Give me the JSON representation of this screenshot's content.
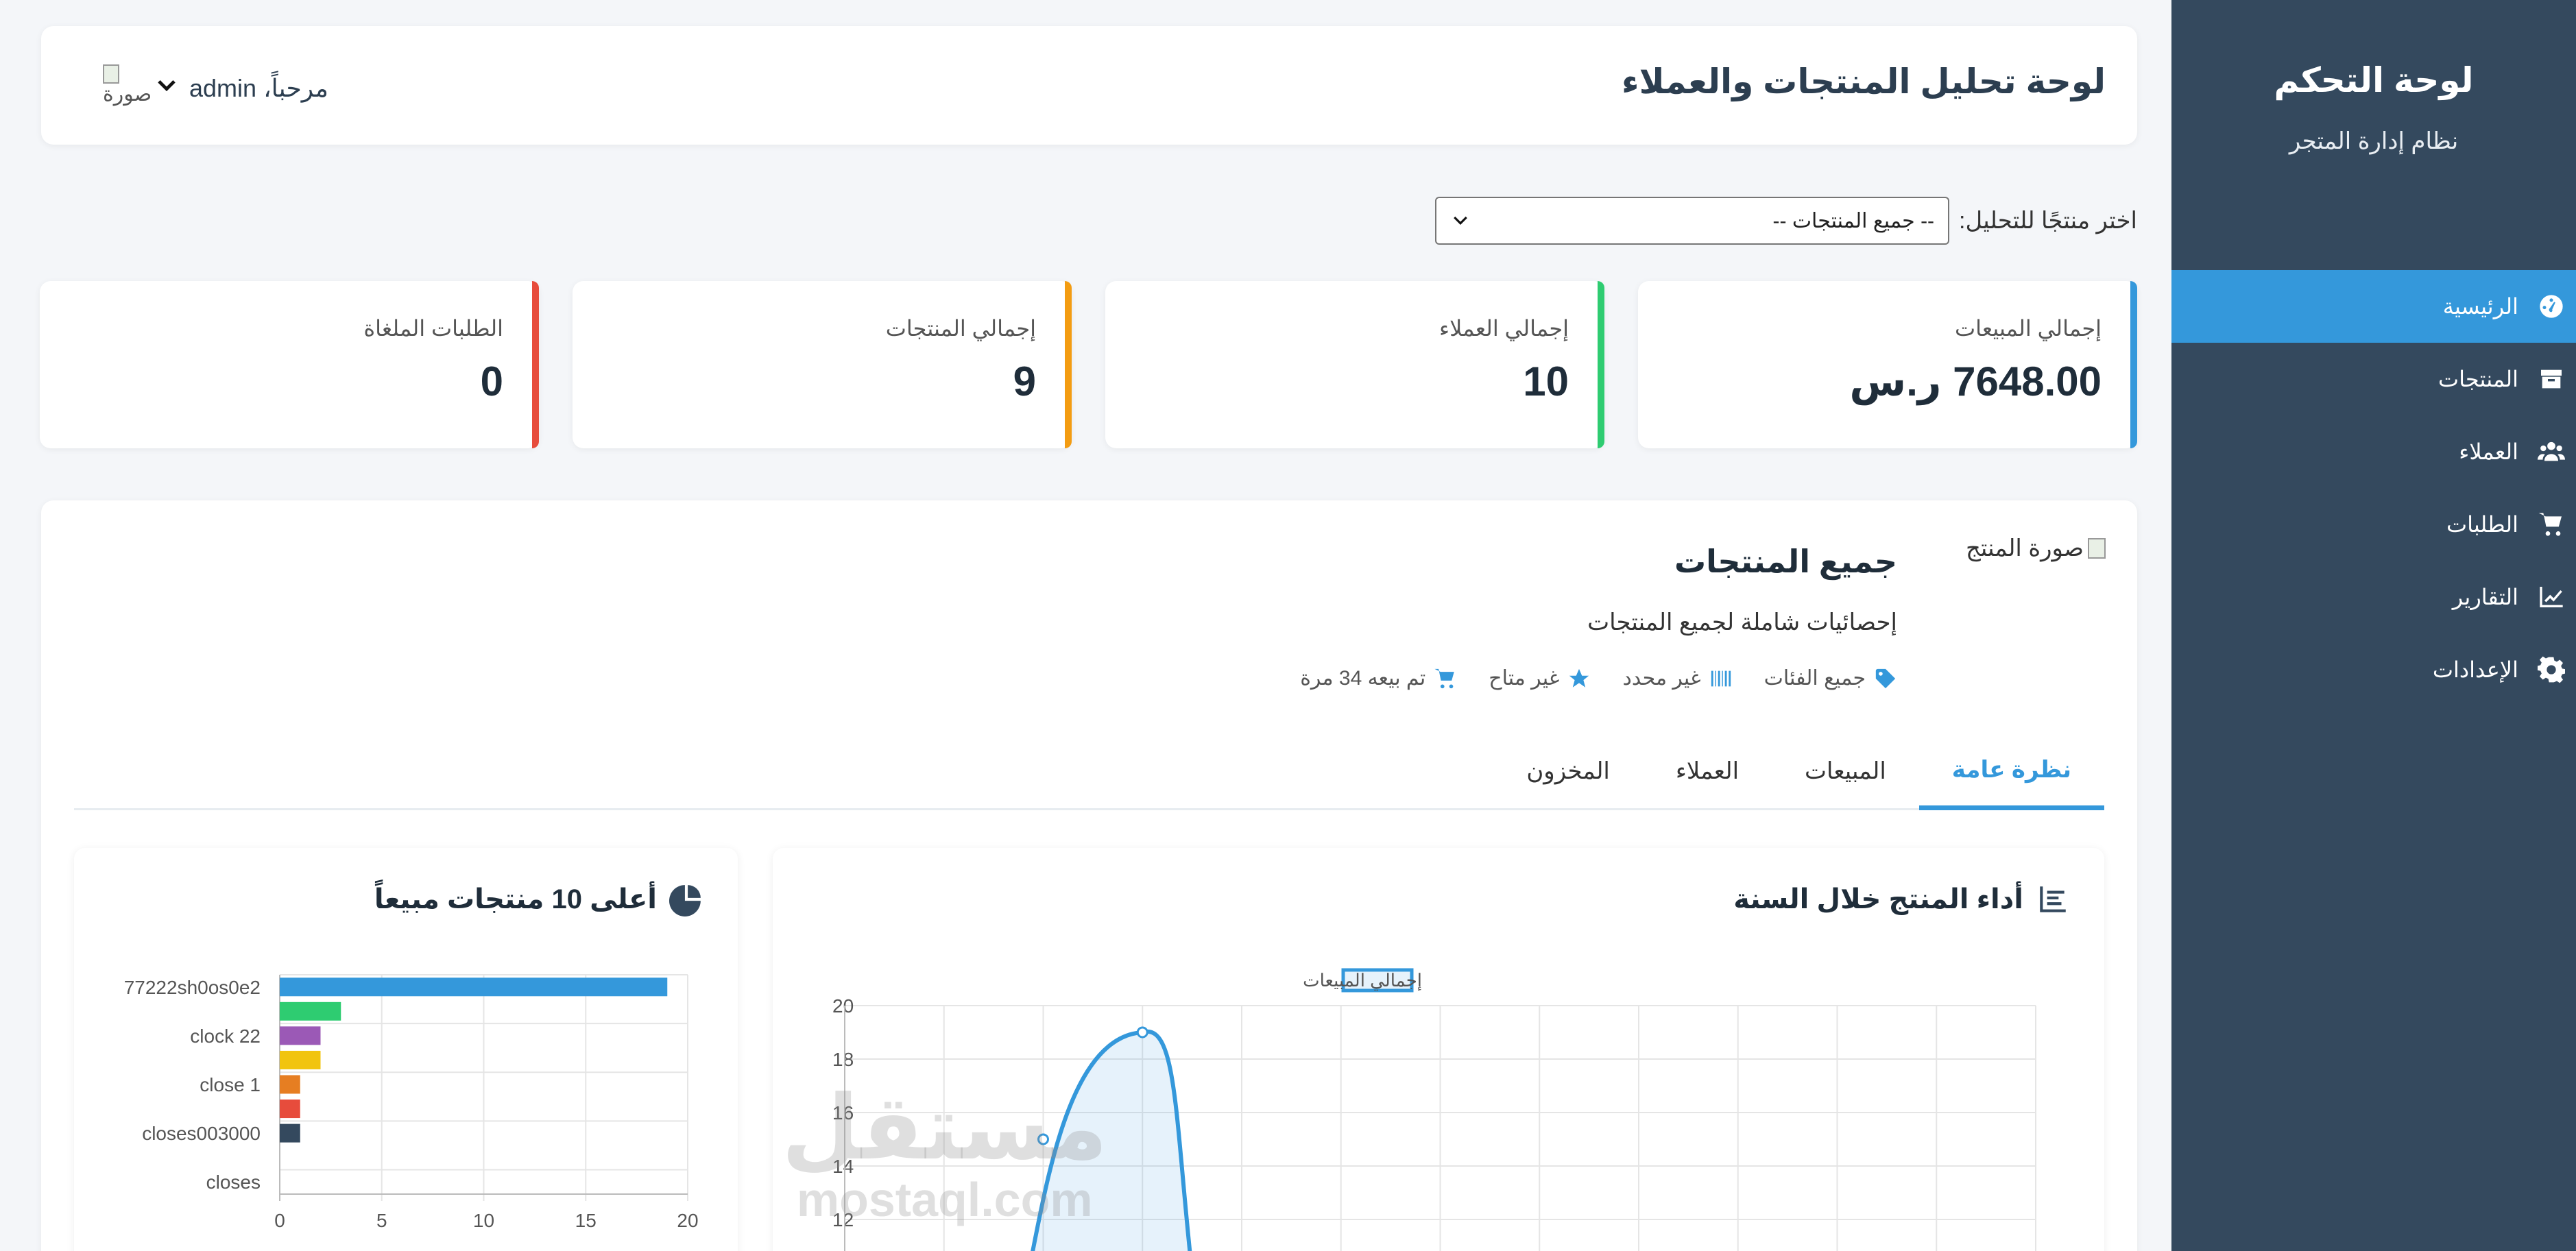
{
  "sidebar": {
    "title": "لوحة التحكم",
    "subtitle": "نظام إدارة المتجر",
    "items": [
      {
        "label": "الرئيسية",
        "icon": "dashboard-icon",
        "active": true
      },
      {
        "label": "المنتجات",
        "icon": "box-icon",
        "active": false
      },
      {
        "label": "العملاء",
        "icon": "users-icon",
        "active": false
      },
      {
        "label": "الطلبات",
        "icon": "cart-icon",
        "active": false
      },
      {
        "label": "التقارير",
        "icon": "chart-line-icon",
        "active": false
      },
      {
        "label": "الإعدادات",
        "icon": "gear-icon",
        "active": false
      }
    ]
  },
  "header": {
    "title": "لوحة تحليل المنتجات والعملاء",
    "greeting": "مرحباً، admin",
    "avatar_alt": "صورة"
  },
  "selector": {
    "label": "اختر منتجًا للتحليل:",
    "selected": "-- جميع المنتجات --"
  },
  "stats": [
    {
      "label": "إجمالي المبيعات",
      "value": "7648.00 ر.س",
      "color": "#3498db"
    },
    {
      "label": "إجمالي العملاء",
      "value": "10",
      "color": "#2ecc71"
    },
    {
      "label": "إجمالي المنتجات",
      "value": "9",
      "color": "#f39c12"
    },
    {
      "label": "الطلبات الملغاة",
      "value": "0",
      "color": "#e74c3c"
    }
  ],
  "product": {
    "image_alt": "صورة المنتج",
    "name": "جميع المنتجات",
    "description": "إحصائيات شاملة لجميع المنتجات",
    "meta": [
      {
        "icon": "tag-icon",
        "text": "جميع الفئات"
      },
      {
        "icon": "barcode-icon",
        "text": "غير محدد"
      },
      {
        "icon": "star-icon",
        "text": "غير متاح"
      },
      {
        "icon": "cart-icon",
        "text": "تم بيعه 34 مرة"
      }
    ]
  },
  "tabs": [
    {
      "label": "نظرة عامة",
      "active": true
    },
    {
      "label": "المبيعات",
      "active": false
    },
    {
      "label": "العملاء",
      "active": false
    },
    {
      "label": "المخزون",
      "active": false
    }
  ],
  "perf_card": {
    "title": "أداء المنتج خلال السنة"
  },
  "top_card": {
    "title": "أعلى 10 منتجات مبيعاً"
  },
  "watermark": {
    "ar": "مستقل",
    "en": "mostaql.com"
  },
  "chart_data": [
    {
      "type": "area",
      "legend": [
        "إجمالي المبيعات"
      ],
      "legend_position": "top",
      "series": [
        {
          "name": "إجمالي المبيعات",
          "points": [
            [
              1.85,
              10
            ],
            [
              2,
              15
            ],
            [
              3,
              19
            ],
            [
              3.5,
              10
            ]
          ],
          "color": "#3498db"
        }
      ],
      "x_gridlines": 12,
      "yticks": [
        12,
        14,
        16,
        18,
        20
      ],
      "ylim": [
        10,
        20
      ],
      "grid": true
    },
    {
      "type": "bar",
      "orientation": "horizontal",
      "categories": [
        "77222sh0os0e2",
        "",
        "clock 22",
        "",
        "close 1",
        "",
        "closes003000",
        "",
        "closes"
      ],
      "values": [
        19,
        3,
        2,
        2,
        1,
        1,
        1,
        0,
        0
      ],
      "colors": [
        "#3498db",
        "#2ecc71",
        "#9b59b6",
        "#f1c40f",
        "#e67e22",
        "#e74c3c",
        "#34495e",
        "#3498db",
        "#2ecc71"
      ],
      "xticks": [
        0,
        5,
        10,
        15,
        20
      ],
      "xlim": [
        0,
        20
      ],
      "grid": true
    }
  ]
}
